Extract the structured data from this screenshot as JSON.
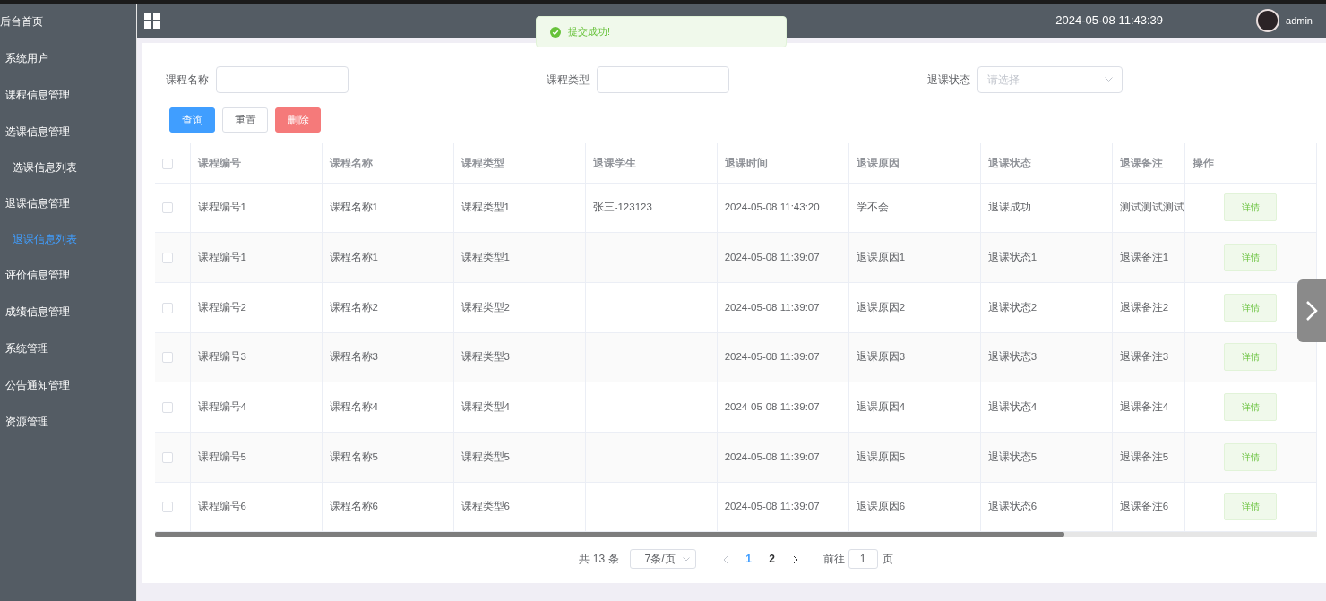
{
  "sidebar": {
    "items": [
      {
        "label": "后台首页",
        "selected": false
      },
      {
        "label": "系统用户",
        "selected": false
      },
      {
        "label": "课程信息管理",
        "selected": false
      },
      {
        "label": "选课信息管理",
        "selected": false,
        "children": [
          {
            "label": "选课信息列表",
            "selected": false
          }
        ]
      },
      {
        "label": "退课信息管理",
        "selected": false,
        "children": [
          {
            "label": "退课信息列表",
            "selected": true
          }
        ]
      },
      {
        "label": "评价信息管理",
        "selected": false
      },
      {
        "label": "成绩信息管理",
        "selected": false
      },
      {
        "label": "系统管理",
        "selected": false
      },
      {
        "label": "公告通知管理",
        "selected": false
      },
      {
        "label": "资源管理",
        "selected": false
      }
    ]
  },
  "header": {
    "datetime": "2024-05-08 11:43:39",
    "user": "admin"
  },
  "toast": {
    "message": "提交成功!"
  },
  "filters": [
    {
      "kind": "input",
      "label": "课程名称"
    },
    {
      "kind": "input",
      "label": "课程类型"
    },
    {
      "kind": "select",
      "label": "退课状态",
      "placeholder": "请选择"
    }
  ],
  "buttons": [
    {
      "kind": "primary",
      "label": "查询"
    },
    {
      "kind": "default",
      "label": "重置"
    },
    {
      "kind": "danger",
      "label": "删除"
    }
  ],
  "table": {
    "select_all_checked": false,
    "columns": [
      "课程编号",
      "课程名称",
      "课程类型",
      "退课学生",
      "退课时间",
      "退课原因",
      "退课状态",
      "退课备注",
      "操作"
    ],
    "rows": [
      {
        "checked": false,
        "cells": [
          "课程编号1",
          "课程名称1",
          "课程类型1",
          "张三-123123",
          "2024-05-08 11:43:20",
          "学不会",
          "退课成功",
          "测试测试测试"
        ],
        "action": "详情"
      },
      {
        "checked": false,
        "cells": [
          "课程编号1",
          "课程名称1",
          "课程类型1",
          "",
          "2024-05-08 11:39:07",
          "退课原因1",
          "退课状态1",
          "退课备注1"
        ],
        "action": "详情"
      },
      {
        "checked": false,
        "cells": [
          "课程编号2",
          "课程名称2",
          "课程类型2",
          "",
          "2024-05-08 11:39:07",
          "退课原因2",
          "退课状态2",
          "退课备注2"
        ],
        "action": "详情"
      },
      {
        "checked": false,
        "cells": [
          "课程编号3",
          "课程名称3",
          "课程类型3",
          "",
          "2024-05-08 11:39:07",
          "退课原因3",
          "退课状态3",
          "退课备注3"
        ],
        "action": "详情"
      },
      {
        "checked": false,
        "cells": [
          "课程编号4",
          "课程名称4",
          "课程类型4",
          "",
          "2024-05-08 11:39:07",
          "退课原因4",
          "退课状态4",
          "退课备注4"
        ],
        "action": "详情"
      },
      {
        "checked": false,
        "cells": [
          "课程编号5",
          "课程名称5",
          "课程类型5",
          "",
          "2024-05-08 11:39:07",
          "退课原因5",
          "退课状态5",
          "退课备注5"
        ],
        "action": "详情"
      },
      {
        "checked": false,
        "cells": [
          "课程编号6",
          "课程名称6",
          "课程类型6",
          "",
          "2024-05-08 11:39:07",
          "退课原因6",
          "退课状态6",
          "退课备注6"
        ],
        "action": "详情"
      }
    ]
  },
  "pagination": {
    "total": "共 13 条",
    "page_size": "7条/页",
    "pages": [
      {
        "label": "1",
        "selected": true
      },
      {
        "label": "2",
        "selected": false
      }
    ],
    "goto_label": "前往",
    "goto_value": "1",
    "goto_suffix": "页"
  }
}
